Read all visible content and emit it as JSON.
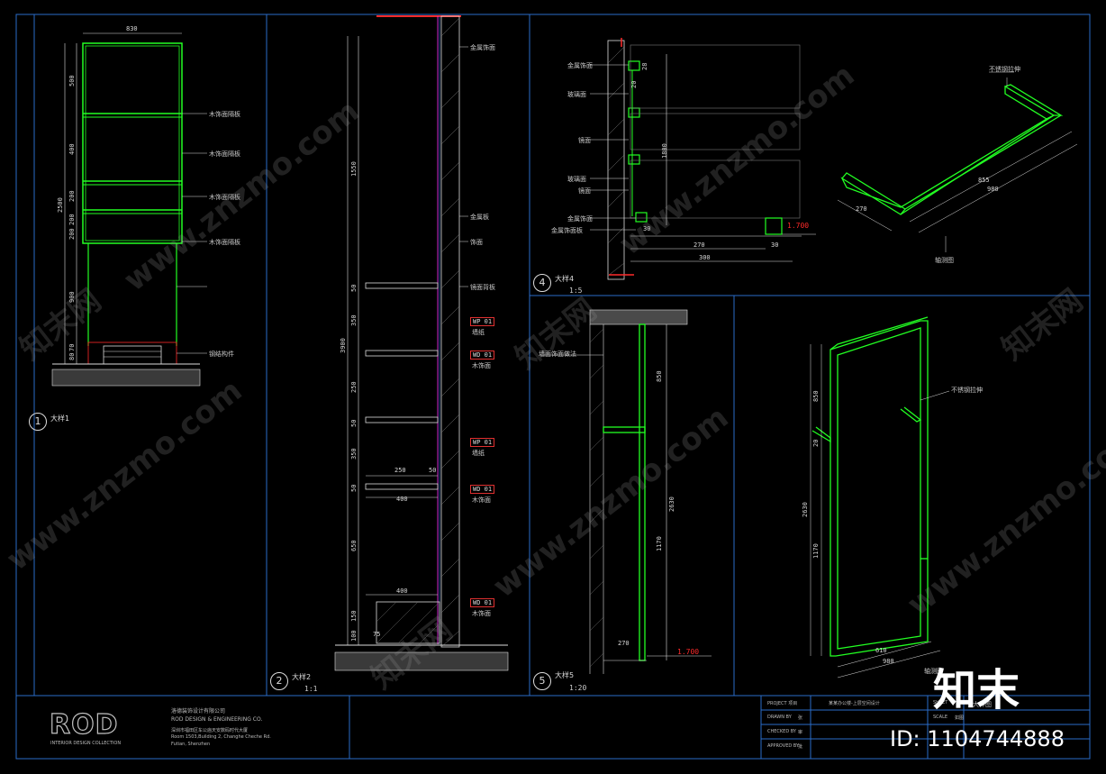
{
  "colors": {
    "background": "#000000",
    "frame": "#2a6cc8",
    "wall_green": "#22ff22",
    "red": "#ff2a2a",
    "magenta": "#ff33ff",
    "dimension": "#d8d8d8"
  },
  "views": [
    {
      "number": "1",
      "title": "大样1"
    },
    {
      "number": "2",
      "title": "大样2",
      "scale": "1:1"
    },
    {
      "number": "4",
      "title": "大样4",
      "scale": "1:5"
    },
    {
      "number": "5",
      "title": "大样5",
      "scale": "1:20"
    }
  ],
  "view1": {
    "dims": [
      "830",
      "500",
      "400",
      "200",
      "200",
      "2500",
      "200",
      "900",
      "80",
      "70"
    ],
    "labels": [
      "木饰面隔板",
      "木饰面隔板",
      "木饰面隔板",
      "木饰面隔板",
      "钢结构件"
    ]
  },
  "view2": {
    "dims": [
      "1550",
      "50",
      "350",
      "3900",
      "250",
      "50",
      "350",
      "50",
      "250",
      "50",
      "400",
      "650",
      "400",
      "150",
      "100",
      "75"
    ],
    "labels": [
      "金属饰面",
      "金属板",
      "饰面",
      "镜面背板"
    ],
    "tags": [
      {
        "code": "WP 01",
        "note": "墙纸"
      },
      {
        "code": "WD 01",
        "note": "木饰面"
      },
      {
        "code": "WP 01",
        "note": "墙纸"
      },
      {
        "code": "WD 01",
        "note": "木饰面"
      },
      {
        "code": "WD 01",
        "note": "木饰面"
      }
    ]
  },
  "view4": {
    "dims": [
      "1800",
      "270",
      "30",
      "300",
      "30",
      "28",
      "20"
    ],
    "labels": [
      "金属饰面",
      "玻璃面",
      "镜面",
      "玻璃面",
      "镜面",
      "金属饰面",
      "金属饰面板"
    ],
    "level": "1.700"
  },
  "view5": {
    "dims": [
      "850",
      "2630",
      "1170",
      "270"
    ],
    "label": "墙面饰面做法",
    "level": "1.700"
  },
  "axo_top": {
    "dims": [
      "270",
      "855",
      "980"
    ],
    "labels": [
      "不锈钢拉伸",
      "轴测图"
    ]
  },
  "axo_right": {
    "dims": [
      "850",
      "20",
      "2630",
      "1170",
      "610",
      "980"
    ],
    "labels": [
      "不锈钢拉伸",
      "轴测图"
    ]
  },
  "company": {
    "logo": "ROD",
    "logo_sub": "INTERIOR DESIGN COLLECTION",
    "name_cn": "洛德装饰设计有限公司",
    "name_en": "ROD DESIGN & ENGINEERING CO.",
    "lines": [
      "深圳市福田区车公庙天安数码时代大厦",
      "Room 1503,Building 2, Changhe Cheche Rd.",
      "Futian, Shenzhen"
    ]
  },
  "title_block": {
    "project_label": "PROJECT 项目",
    "project": "某某办公楼-上层空间设计",
    "drawn_label": "DRAWN BY",
    "drawn": "张",
    "checked_label": "CHECKED BY",
    "checked": "审",
    "approved_label": "APPROVED BY",
    "approved": "批",
    "sheet_label": "SHEET",
    "sheet_title": "大样图",
    "scale_label": "SCALE",
    "scale": "如图"
  },
  "watermark": {
    "site": "www.znzmo.com",
    "brand_cn": "知末网",
    "brand": "知末",
    "id": "ID: 1104744888"
  }
}
